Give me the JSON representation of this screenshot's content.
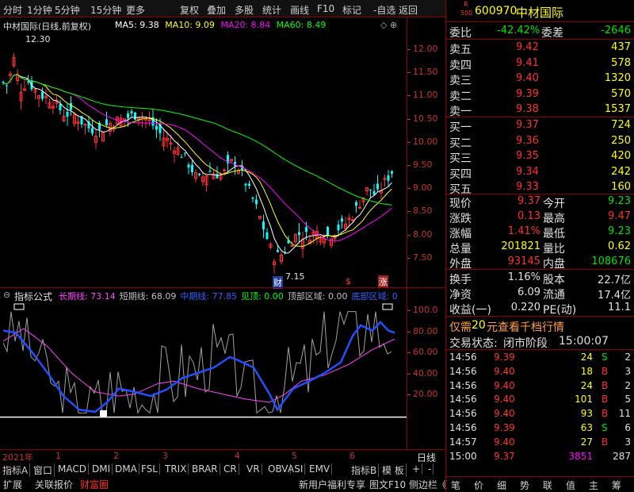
{
  "toolbar": {
    "items": [
      "分时",
      "1分钟",
      "5分钟",
      "15分钟",
      "更多",
      "复权",
      "叠加",
      "多股",
      "统计",
      "画线",
      "F10",
      "标记",
      "-自选",
      "返回"
    ]
  },
  "chart": {
    "title": "中材国际(日线,前复权)",
    "ma5_label": "MA5: 9.38",
    "ma10_label": "MA10: 9.09",
    "ma20_label": "MA20: 8.84",
    "ma60_label": "MA60: 8.49",
    "high_label": "12.30",
    "low_label": "7.15",
    "y_ticks": [
      "12.00",
      "11.50",
      "11.00",
      "10.50",
      "10.00",
      "9.50",
      "9.00",
      "8.50",
      "8.00",
      "7.50"
    ],
    "marker_cai": "财",
    "marker_s": "$",
    "marker_zhang": "涨",
    "colors": {
      "up": "#ff3232",
      "down": "#00ffff",
      "ma5": "#ffffff",
      "ma10": "#ffff00",
      "ma20": "#ff00ff",
      "ma60": "#00ff00"
    }
  },
  "indicator": {
    "name": "指标公式",
    "items": [
      {
        "label": "长期线: 73.14",
        "color": "#ff40ff"
      },
      {
        "label": "短期线: 68.09",
        "color": "#c0c0c0"
      },
      {
        "label": "中期线: 77.85",
        "color": "#3060ff"
      },
      {
        "label": "见顶: 0.00",
        "color": "#00ff00"
      },
      {
        "label": "顶部区域: 0.00",
        "color": "#c0c0c0"
      },
      {
        "label": "底部区域: 0",
        "color": "#3060ff"
      }
    ],
    "y_ticks": [
      "100.0",
      "80.00",
      "60.00",
      "40.00",
      "20.00"
    ]
  },
  "xaxis": {
    "year": "2021年",
    "months": [
      "1",
      "2",
      "3",
      "4",
      "5",
      "6"
    ],
    "period": "日线"
  },
  "bottom": {
    "tabs1": [
      "指标A",
      "窗口",
      "MACD",
      "DMI",
      "DMA",
      "FSL",
      "TRIX",
      "BRAR",
      "CR",
      "VR",
      "OBV",
      "ASI",
      "EMV",
      "指标B",
      "模 板",
      "+",
      "-"
    ],
    "tabs2": [
      "扩展",
      "关联报价",
      "财富圈",
      "新用户福利专享",
      "图文F10",
      "侧边栏《"
    ],
    "right_tabs": [
      "笔",
      "价",
      "细",
      "势",
      "联",
      "值",
      "主",
      "筹"
    ]
  },
  "quote": {
    "code": "600970",
    "name": "中材国际",
    "badge_r": "R",
    "badge_num": "500",
    "weibi_label": "委比",
    "weibi": "-42.42%",
    "weicha_label": "委差",
    "weicha": "-2646",
    "asks": [
      {
        "label": "卖五",
        "price": "9.42",
        "vol": "437"
      },
      {
        "label": "卖四",
        "price": "9.41",
        "vol": "578"
      },
      {
        "label": "卖三",
        "price": "9.40",
        "vol": "1320"
      },
      {
        "label": "卖二",
        "price": "9.39",
        "vol": "570"
      },
      {
        "label": "卖一",
        "price": "9.38",
        "vol": "1537"
      }
    ],
    "bids": [
      {
        "label": "买一",
        "price": "9.37",
        "vol": "724"
      },
      {
        "label": "买二",
        "price": "9.36",
        "vol": "250"
      },
      {
        "label": "买三",
        "price": "9.35",
        "vol": "420"
      },
      {
        "label": "买四",
        "price": "9.34",
        "vol": "242"
      },
      {
        "label": "买五",
        "price": "9.33",
        "vol": "160"
      }
    ],
    "stats": [
      {
        "l1": "现价",
        "v1": "9.37",
        "c1": "red",
        "l2": "今开",
        "v2": "9.23",
        "c2": "green"
      },
      {
        "l1": "涨跌",
        "v1": "0.13",
        "c1": "red",
        "l2": "最高",
        "v2": "9.47",
        "c2": "red"
      },
      {
        "l1": "涨幅",
        "v1": "1.41%",
        "c1": "red",
        "l2": "最低",
        "v2": "9.23",
        "c2": "green"
      },
      {
        "l1": "总量",
        "v1": "201821",
        "c1": "yel",
        "l2": "量比",
        "v2": "0.62",
        "c2": "yel"
      },
      {
        "l1": "外盘",
        "v1": "93145",
        "c1": "red",
        "l2": "内盘",
        "v2": "108676",
        "c2": "green"
      }
    ],
    "stats2": [
      {
        "l1": "换手",
        "v1": "1.16%",
        "l2": "股本",
        "v2": "22.7亿"
      },
      {
        "l1": "净资",
        "v1": "6.09",
        "l2": "流通",
        "v2": "17.4亿"
      },
      {
        "l1": "收益(一)",
        "v1": "0.220",
        "l2": "PE(动)",
        "v2": "11.1"
      }
    ],
    "promo_a": "仅需",
    "promo_b": "20",
    "promo_c": "元查看千档行情",
    "status_label": "交易状态:",
    "status_value": "闭市阶段",
    "status_time": "15:00:07",
    "ticks": [
      {
        "t": "14:56",
        "p": "9.39",
        "v": "24",
        "d": "S",
        "n": "2",
        "pc": "red",
        "dc": "green"
      },
      {
        "t": "14:56",
        "p": "9.40",
        "v": "18",
        "d": "B",
        "n": "3",
        "pc": "red",
        "dc": "red"
      },
      {
        "t": "14:56",
        "p": "9.40",
        "v": "24",
        "d": "B",
        "n": "2",
        "pc": "red",
        "dc": "red"
      },
      {
        "t": "14:56",
        "p": "9.40",
        "v": "101",
        "d": "B",
        "n": "5",
        "pc": "red",
        "dc": "red"
      },
      {
        "t": "14:56",
        "p": "9.40",
        "v": "93",
        "d": "B",
        "n": "11",
        "pc": "red",
        "dc": "red"
      },
      {
        "t": "14:56",
        "p": "9.39",
        "v": "63",
        "d": "S",
        "n": "6",
        "pc": "red",
        "dc": "green"
      },
      {
        "t": "14:57",
        "p": "9.40",
        "v": "27",
        "d": "B",
        "n": "3",
        "pc": "red",
        "dc": "red"
      },
      {
        "t": "15:00",
        "p": "9.37",
        "v": "3851",
        "d": "",
        "n": "287",
        "pc": "red",
        "dc": "red"
      }
    ]
  }
}
